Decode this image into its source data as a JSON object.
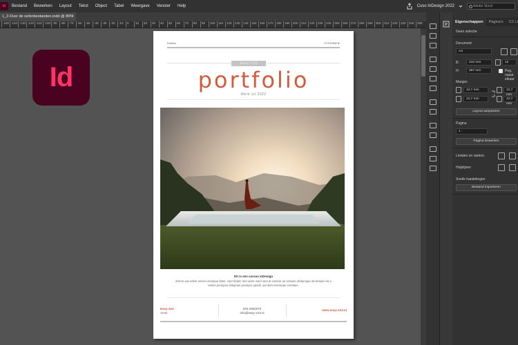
{
  "menubar": {
    "app_glyph": "Id",
    "items": [
      "Bestand",
      "Bewerken",
      "Layout",
      "Tekst",
      "Object",
      "Tabel",
      "Weergave",
      "Venster",
      "Help"
    ],
    "workspace": "Cuso InDesign 2022",
    "stock_search_placeholder": "Adobe Stock"
  },
  "document_tab": {
    "label": "1_2-Over de oefenbestanden.indd @ 80%",
    "close": "×"
  },
  "ruler": {
    "ticks": [
      "-150",
      "-140",
      "-130",
      "-120",
      "-110",
      "-100",
      "-90",
      "-80",
      "-70",
      "-60",
      "-50",
      "-40",
      "-30",
      "-20",
      "-10",
      "0",
      "10",
      "20",
      "30",
      "40",
      "50",
      "60",
      "70",
      "80",
      "90",
      "100",
      "110",
      "120",
      "130",
      "140",
      "150",
      "160",
      "170",
      "180",
      "190",
      "200",
      "210",
      "220",
      "230",
      "240",
      "250",
      "260",
      "270",
      "280",
      "290",
      "300",
      "310",
      "320",
      "330",
      "340",
      "350",
      "360"
    ]
  },
  "logo": {
    "text": "Id",
    "bg": "#49021f",
    "fg": "#ff3366"
  },
  "page": {
    "header_left": "Portfolio",
    "header_right": "FOTOGRAFIE",
    "badge": "Easy-123",
    "title": "portfolio",
    "subtitle": "Werk uit 2022",
    "caption_title": "Dit is een cursus InDesign",
    "caption_body": "Enime aut velent vercim eoseque blam, sunt ficiatit, tem utem meris tem te conctur ae veriatur dicitumque de-temium int a velore prempos dolupnan prempor apedit, qui dem eosseque cernatus.",
    "footer_name": "Easy-123",
    "footer_city": "Amer",
    "footer_phone": "040-2902070",
    "footer_mail": "info@easy-123.nl",
    "footer_web": "www.easy-123.nl",
    "accent": "#d45a3c"
  },
  "panel": {
    "tabs": [
      "Eigenschappen",
      "Pagina's",
      "CC Libraries"
    ],
    "no_selection": "Geen selectie",
    "document_label": "Document",
    "document_size": "A4",
    "width_label": "B:",
    "width_value": "210 mm",
    "height_label": "H:",
    "height_value": "297 mm",
    "pages_count": "12",
    "facing_pages_label": "Peg. naast elkaar",
    "margins_label": "Marges",
    "margin_values": [
      "12,7 mm",
      "12,7 mm",
      "12,7 mm",
      "12,7 mm"
    ],
    "layout_adjust_button": "Layout aanpassen",
    "page_label": "Pagina",
    "page_value": "1",
    "edit_page_button": "Pagina bewerken",
    "rulers_label": "Linialen en rasters",
    "guides_label": "Hulplijnen",
    "quick_actions_label": "Snelle handelingen",
    "import_button": "Bestand importeren"
  }
}
